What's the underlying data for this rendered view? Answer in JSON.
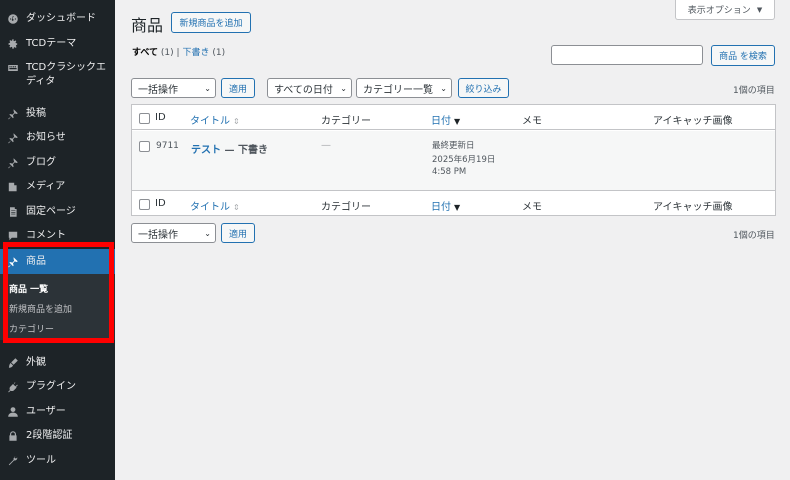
{
  "sidebar": {
    "items": [
      {
        "label": "ダッシュボード",
        "icon": "dashboard-icon"
      },
      {
        "label": "TCDテーマ",
        "icon": "gear-icon"
      },
      {
        "label": "TCDクラシックエディタ",
        "icon": "keyboard-icon"
      },
      {
        "label": "投稿",
        "icon": "pin-icon"
      },
      {
        "label": "お知らせ",
        "icon": "pin-icon"
      },
      {
        "label": "ブログ",
        "icon": "pin-icon"
      },
      {
        "label": "メディア",
        "icon": "media-icon"
      },
      {
        "label": "固定ページ",
        "icon": "page-icon"
      },
      {
        "label": "コメント",
        "icon": "comment-icon"
      },
      {
        "label": "商品",
        "icon": "pin-icon"
      },
      {
        "label": "外観",
        "icon": "brush-icon"
      },
      {
        "label": "プラグイン",
        "icon": "plugin-icon"
      },
      {
        "label": "ユーザー",
        "icon": "user-icon"
      },
      {
        "label": "2段階認証",
        "icon": "lock-icon"
      },
      {
        "label": "ツール",
        "icon": "wrench-icon"
      }
    ],
    "submenu": [
      "商品 一覧",
      "新規商品を追加",
      "カテゴリー"
    ]
  },
  "header": {
    "title": "商品",
    "add_new": "新規商品を追加",
    "screen_options": "表示オプション",
    "screen_options_arrow": "▼"
  },
  "filters": {
    "all_label": "すべて",
    "all_count": "(1)",
    "sep": "|",
    "draft_label": "下書き",
    "draft_count": "(1)",
    "search_button": "商品 を検索",
    "bulk_action": "一括操作",
    "apply": "適用",
    "date_filter": "すべての日付",
    "category_filter": "カテゴリー一覧",
    "filter_button": "絞り込み",
    "items_count": "1個の項目"
  },
  "table": {
    "columns": {
      "id": "ID",
      "title": "タイトル",
      "category": "カテゴリー",
      "date": "日付",
      "memo": "メモ",
      "eyecatch": "アイキャッチ画像"
    },
    "sort_icon": "⇕",
    "sort_icon_active": "▼",
    "row": {
      "id": "9711",
      "title": "テスト",
      "state": " — 下書き",
      "category": "—",
      "date_label": "最終更新日",
      "date": "2025年6月19日",
      "time": "4:58 PM"
    }
  },
  "colors": {
    "sidebar_bg": "#1d2327",
    "accent": "#2271b1",
    "highlight": "#ff0000"
  }
}
